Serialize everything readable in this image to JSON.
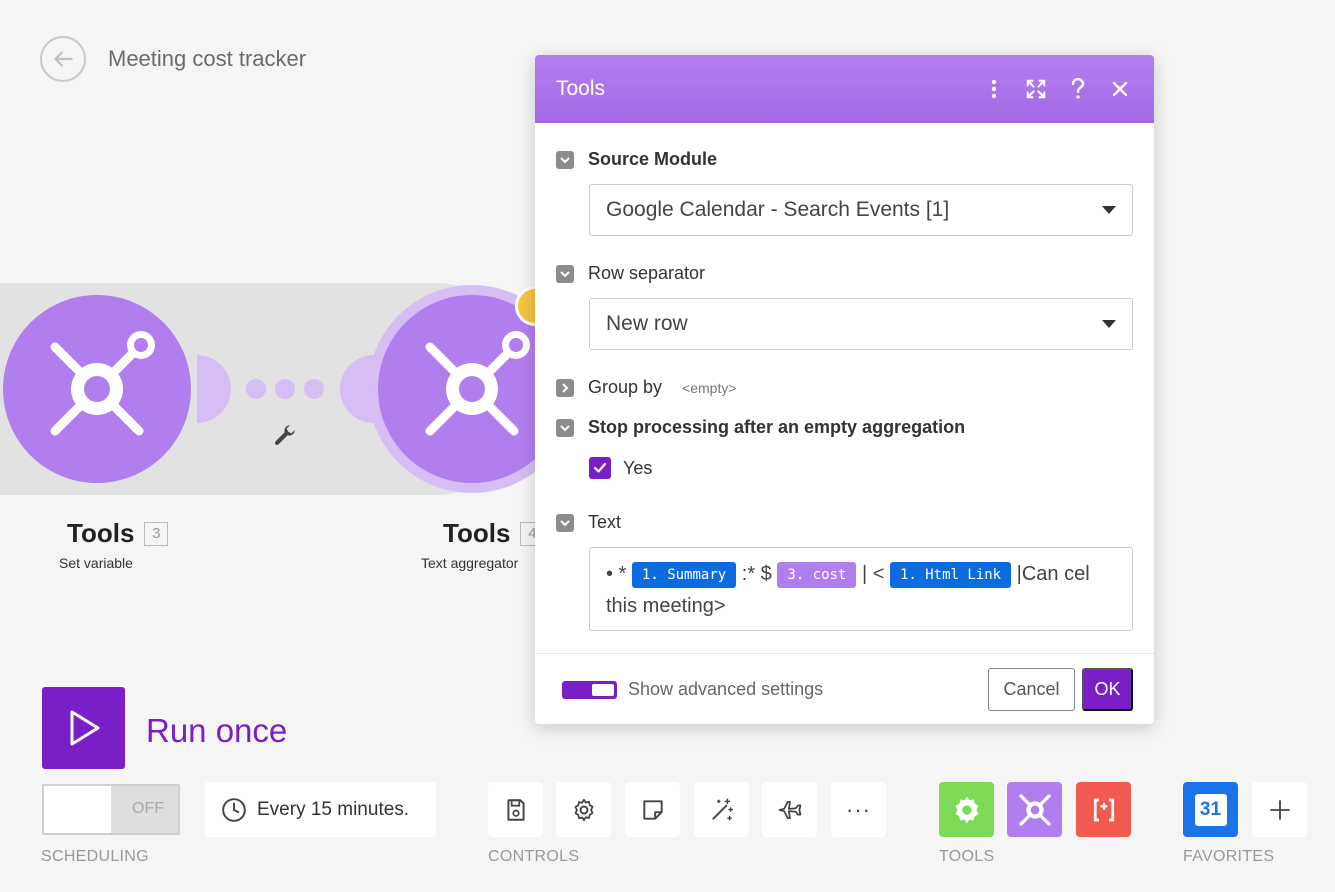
{
  "header": {
    "title": "Meeting cost tracker",
    "back_icon": "arrow-left-icon"
  },
  "modules": [
    {
      "name": "Tools",
      "number": "3",
      "subtitle": "Set variable"
    },
    {
      "name": "Tools",
      "number": "4",
      "subtitle": "Text aggregator"
    }
  ],
  "run": {
    "label": "Run once"
  },
  "toolbar": {
    "scheduling": {
      "state": "OFF",
      "interval": "Every 15 minutes.",
      "label": "SCHEDULING"
    },
    "controls_label": "CONTROLS",
    "tools_label": "TOOLS",
    "favorites_label": "FAVORITES",
    "more": "···",
    "calendar_day": "31"
  },
  "dialog": {
    "title": "Tools",
    "source_module": {
      "label": "Source Module",
      "value": "Google Calendar - Search Events [1]"
    },
    "row_separator": {
      "label": "Row separator",
      "value": "New row"
    },
    "group_by": {
      "label": "Group by",
      "value": "<empty>"
    },
    "stop_processing": {
      "label": "Stop processing after an empty aggregation",
      "option": "Yes",
      "checked": true
    },
    "text": {
      "label": "Text",
      "prefix": "• *",
      "token1": "1. Summary",
      "mid1": ":* $",
      "token2": "3. cost",
      "mid2": " | <",
      "token3": "1. Html Link",
      "suffix": "|Can cel this meeting>"
    },
    "advanced": {
      "label": "Show advanced settings",
      "enabled": true
    },
    "cancel_label": "Cancel",
    "ok_label": "OK"
  },
  "colors": {
    "accent": "#7a1fc8",
    "module": "#b17fed",
    "tools_green": "#7ed957",
    "tools_red": "#f25a4f",
    "calendar_blue": "#1a73e8"
  }
}
